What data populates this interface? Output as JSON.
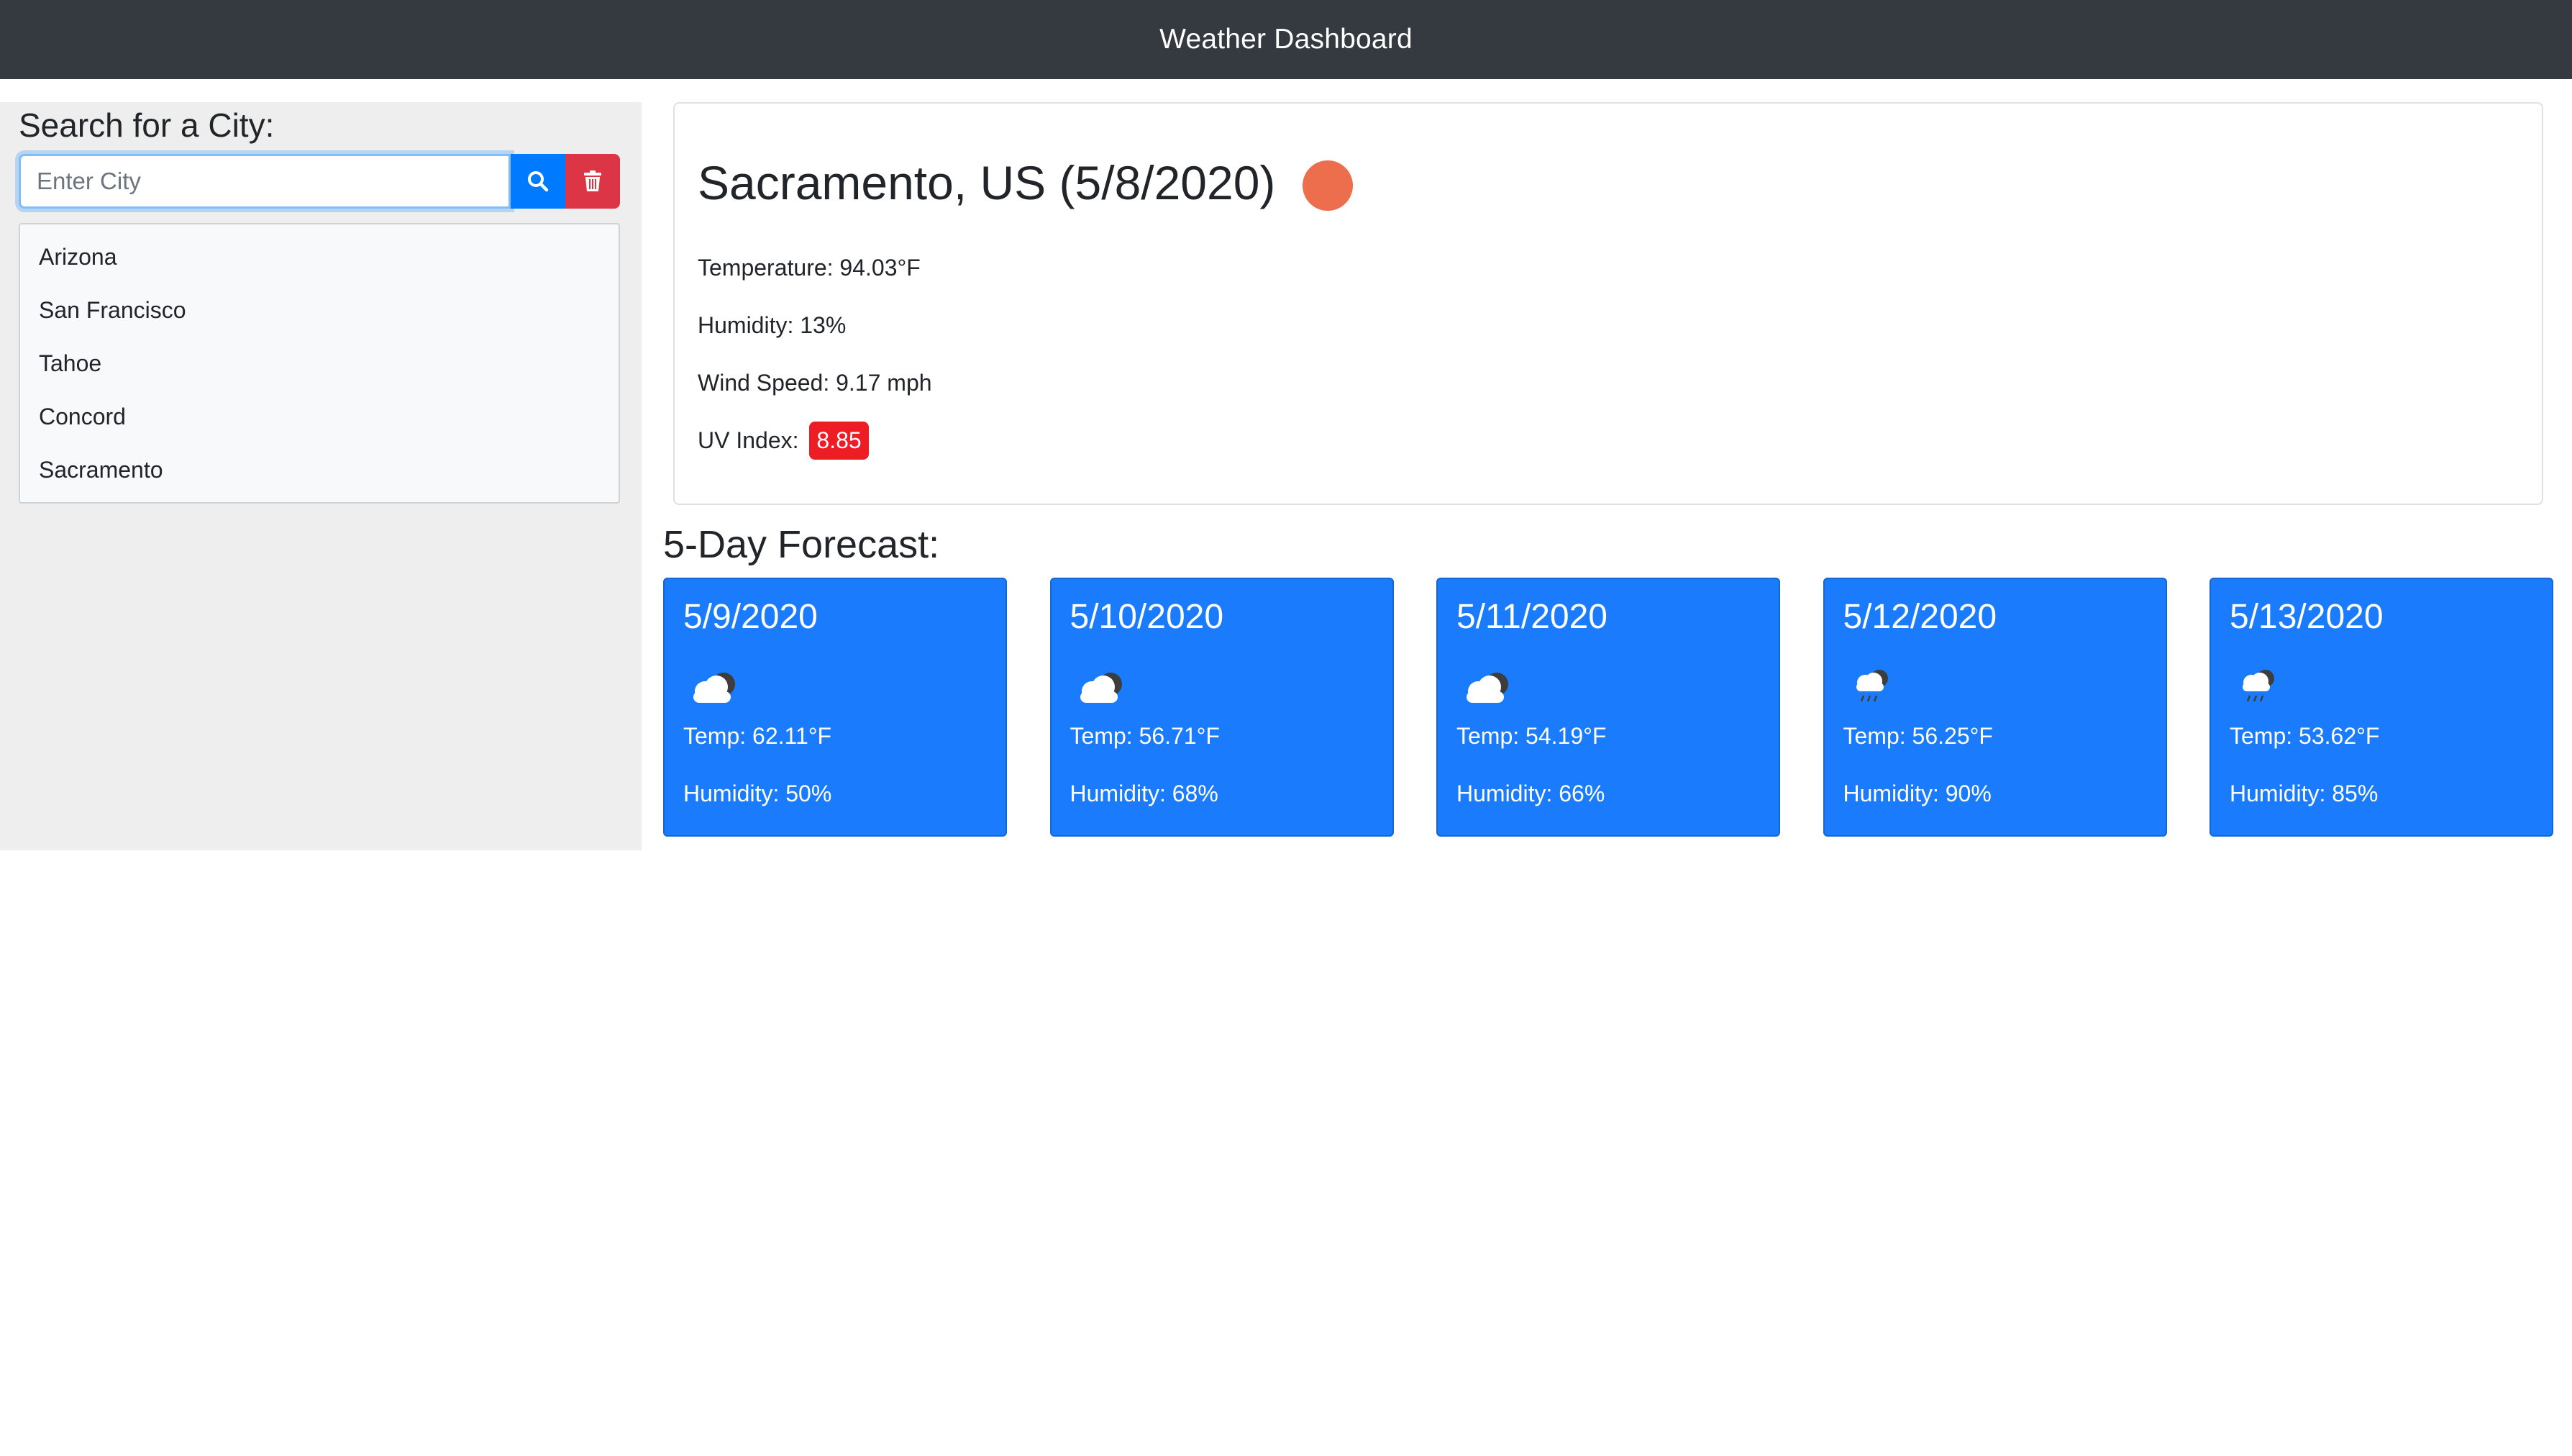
{
  "header": {
    "title": "Weather Dashboard"
  },
  "sidebar": {
    "heading": "Search for a City:",
    "search": {
      "placeholder": "Enter City",
      "value": ""
    },
    "search_button_icon": "search-icon",
    "clear_button_icon": "trash-icon",
    "cities": [
      "Arizona",
      "San Francisco",
      "Tahoe",
      "Concord",
      "Sacramento"
    ]
  },
  "current": {
    "title": "Sacramento, US (5/8/2020)",
    "icon": "sun-icon",
    "icon_color": "#ec6e4c",
    "temperature": "Temperature: 94.03°F",
    "humidity": "Humidity: 13%",
    "wind": "Wind Speed: 9.17 mph",
    "uv_label": "UV Index:",
    "uv_value": "8.85",
    "uv_color": "#ee1c25"
  },
  "forecast": {
    "heading": "5-Day Forecast:",
    "days": [
      {
        "date": "5/9/2020",
        "icon": "cloud-icon",
        "temp": "Temp: 62.11°F",
        "humidity": "Humidity: 50%"
      },
      {
        "date": "5/10/2020",
        "icon": "cloud-icon",
        "temp": "Temp: 56.71°F",
        "humidity": "Humidity: 68%"
      },
      {
        "date": "5/11/2020",
        "icon": "cloud-icon",
        "temp": "Temp: 54.19°F",
        "humidity": "Humidity: 66%"
      },
      {
        "date": "5/12/2020",
        "icon": "rain-cloud-icon",
        "temp": "Temp: 56.25°F",
        "humidity": "Humidity: 90%"
      },
      {
        "date": "5/13/2020",
        "icon": "rain-cloud-icon",
        "temp": "Temp: 53.62°F",
        "humidity": "Humidity: 85%"
      }
    ]
  },
  "colors": {
    "header_bg": "#343a40",
    "primary": "#007bff",
    "danger": "#dc3545",
    "forecast_card": "#1a7cfd"
  }
}
